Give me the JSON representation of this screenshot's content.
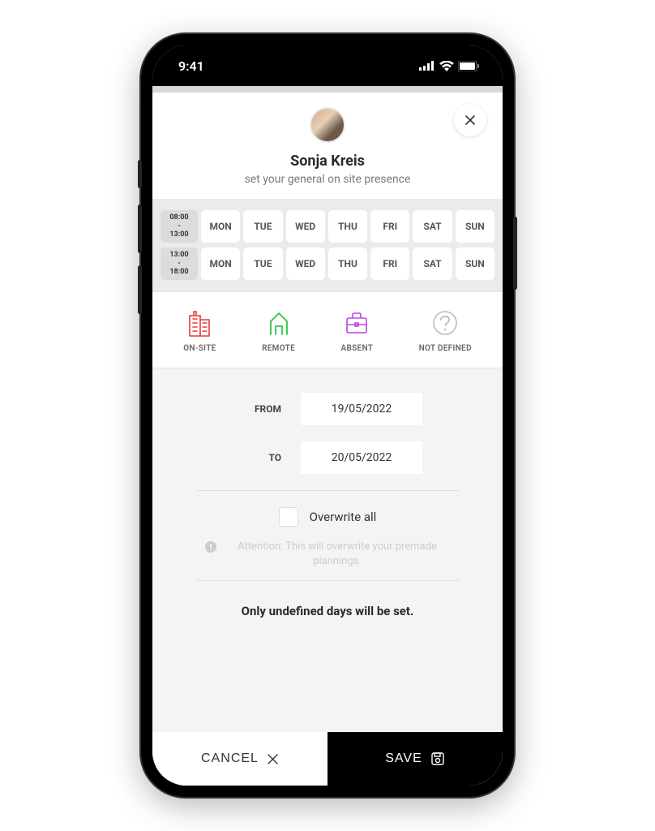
{
  "status": {
    "time": "9:41"
  },
  "header": {
    "name": "Sonja Kreis",
    "subtitle": "set your general on site presence"
  },
  "schedule": {
    "rows": [
      {
        "start": "08:00",
        "end": "13:00",
        "days": [
          "MON",
          "TUE",
          "WED",
          "THU",
          "FRI",
          "SAT",
          "SUN"
        ]
      },
      {
        "start": "13:00",
        "end": "18:00",
        "days": [
          "MON",
          "TUE",
          "WED",
          "THU",
          "FRI",
          "SAT",
          "SUN"
        ]
      }
    ]
  },
  "presence": {
    "onsite": "ON-SITE",
    "remote": "REMOTE",
    "absent": "ABSENT",
    "notdefined": "NOT DEFINED"
  },
  "form": {
    "from_label": "FROM",
    "from_value": "19/05/2022",
    "to_label": "TO",
    "to_value": "20/05/2022",
    "overwrite_label": "Overwrite all",
    "warning": "Attention: This will overwrite your premade plannings.",
    "info": "Only undefined days will be set."
  },
  "buttons": {
    "cancel": "CANCEL",
    "save": "SAVE"
  }
}
